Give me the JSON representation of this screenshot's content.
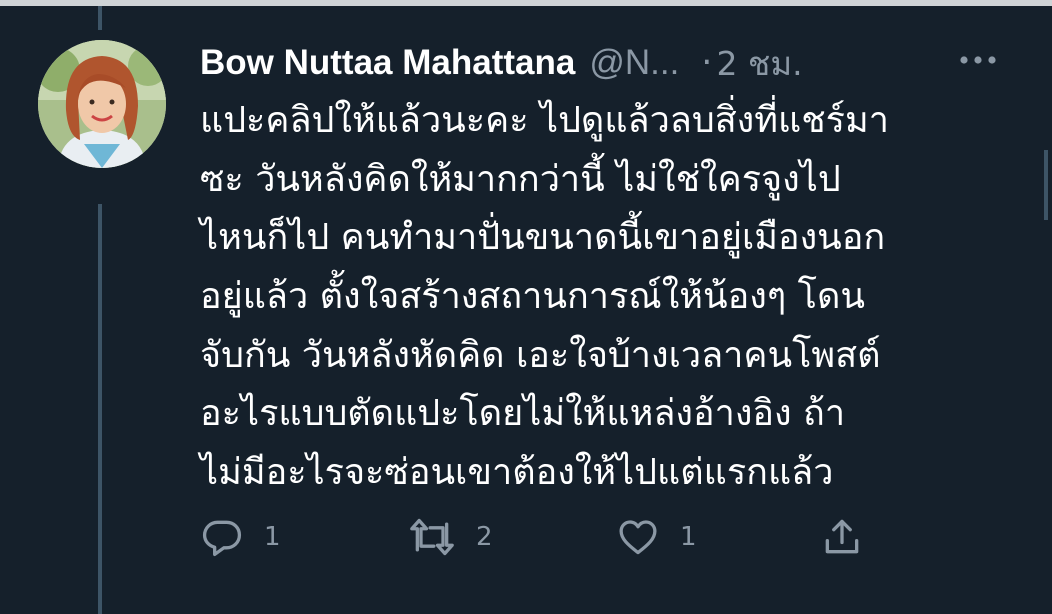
{
  "tweet": {
    "author_name": "Bow Nuttaa Mahattana",
    "author_handle": "@N...",
    "separator": "·",
    "time": "2 ชม.",
    "more_icon": "more-horizontal-icon",
    "avatar": "profile-photo",
    "body_lines": [
      "แปะคลิปให้แล้วนะคะ ไปดูแล้วลบสิ่งที่แชร์มา",
      "ซะ วันหลังคิดให้มากกว่านี้ ไม่ใช่ใครจูงไป",
      "ไหนก็ไป คนทำมาปั่นขนาดนี้เขาอยู่เมืองนอก",
      "อยู่แล้ว ตั้งใจสร้างสถานการณ์ให้น้องๆ โดน",
      "จับกัน วันหลังหัดคิด เอะใจบ้างเวลาคนโพสต์",
      "อะไรแบบตัดแปะโดยไม่ให้แหล่งอ้างอิง ถ้า",
      "ไม่มีอะไรจะซ่อนเขาต้องให้ไปแต่แรกแล้ว"
    ],
    "actions": {
      "reply": {
        "icon": "reply-icon",
        "count": "1"
      },
      "retweet": {
        "icon": "retweet-icon",
        "count": "2"
      },
      "like": {
        "icon": "heart-icon",
        "count": "1"
      },
      "share": {
        "icon": "share-icon"
      }
    }
  },
  "colors": {
    "background": "#15202b",
    "text_primary": "#ffffff",
    "text_secondary": "#8b98a5",
    "thread_line": "#3d5466"
  }
}
